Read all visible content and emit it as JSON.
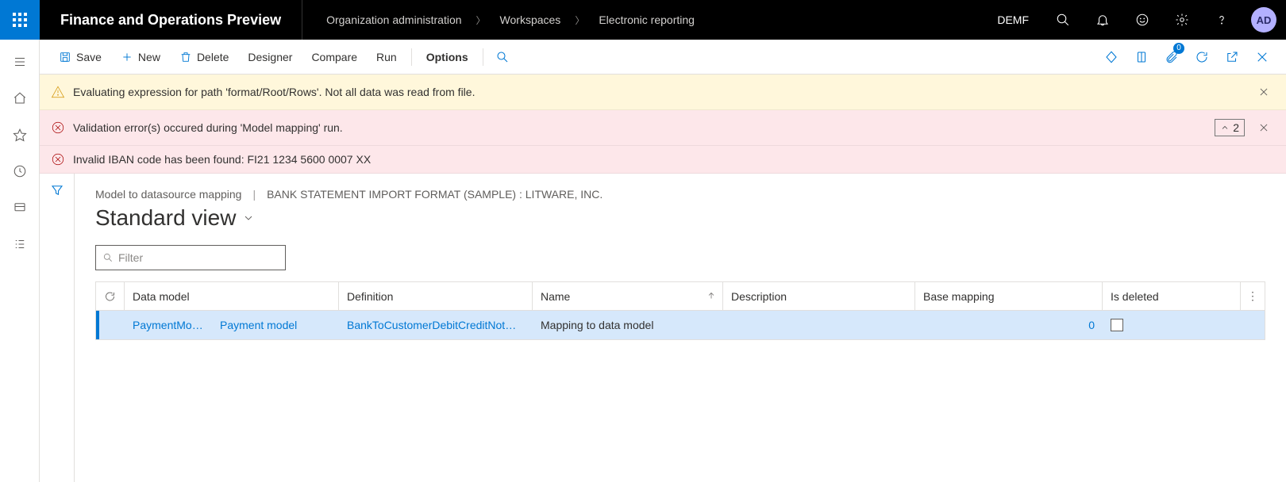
{
  "header": {
    "app_title": "Finance and Operations Preview",
    "breadcrumb": [
      "Organization administration",
      "Workspaces",
      "Electronic reporting"
    ],
    "company": "DEMF",
    "avatar_initials": "AD"
  },
  "action_pane": {
    "save": "Save",
    "new": "New",
    "delete": "Delete",
    "designer": "Designer",
    "compare": "Compare",
    "run": "Run",
    "options": "Options",
    "attachments_badge": "0"
  },
  "messages": {
    "warn": "Evaluating expression for path 'format/Root/Rows'.  Not all data was read from file.",
    "err_summary": "Validation error(s) occured during 'Model mapping' run.",
    "err_detail": "Invalid IBAN code has been found: FI21 1234 5600 0007 XX",
    "err_count": "2"
  },
  "page": {
    "context_left": "Model to datasource mapping",
    "context_right": "BANK STATEMENT IMPORT FORMAT (SAMPLE) : LITWARE, INC.",
    "view_name": "Standard view",
    "filter_placeholder": "Filter"
  },
  "grid": {
    "columns": {
      "data_model": "Data model",
      "definition": "Definition",
      "name": "Name",
      "description": "Description",
      "base_mapping": "Base mapping",
      "is_deleted": "Is deleted"
    },
    "rows": [
      {
        "data_model_code": "PaymentMo…",
        "data_model_name": "Payment model",
        "definition": "BankToCustomerDebitCreditNot…",
        "name": "Mapping to data model",
        "description": "",
        "base_mapping": "0",
        "is_deleted": false
      }
    ]
  }
}
